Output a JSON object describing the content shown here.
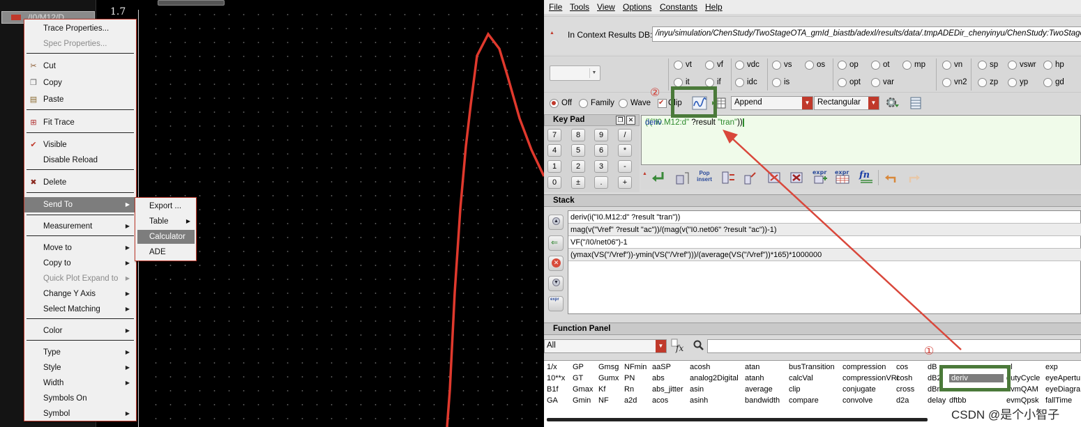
{
  "waveform": {
    "trace_name": "/I0/M12/D",
    "y_tick": "1.7",
    "trace_color": "#e0392d",
    "grid_color": "#5a5a5a"
  },
  "context_menu": {
    "trace_properties": "Trace Properties...",
    "spec_properties": "Spec Properties...",
    "cut": "Cut",
    "copy": "Copy",
    "paste": "Paste",
    "fit_trace": "Fit Trace",
    "visible": "Visible",
    "disable_reload": "Disable Reload",
    "delete": "Delete",
    "send_to": "Send To",
    "measurement": "Measurement",
    "move_to": "Move to",
    "copy_to": "Copy to",
    "quick_plot": "Quick Plot Expand to",
    "change_y_axis": "Change Y Axis",
    "select_matching": "Select Matching",
    "color": "Color",
    "type": "Type",
    "style": "Style",
    "width": "Width",
    "symbols_on": "Symbols On",
    "symbol": "Symbol"
  },
  "send_to_submenu": {
    "export": "Export ...",
    "table": "Table",
    "calculator": "Calculator",
    "ade": "ADE"
  },
  "calculator": {
    "menu": [
      "File",
      "Tools",
      "View",
      "Options",
      "Constants",
      "Help"
    ],
    "context_label": "In Context Results DB:",
    "context_path": "/inyu/simulation/ChenStudy/TwoStageOTA_gmId_biastb/adexl/results/data/.tmpADEDir_chenyinyu/ChenStudy:TwoStage",
    "signal_radios": [
      "vt",
      "vf",
      "vdc",
      "vs",
      "os",
      "op",
      "ot",
      "mp",
      "vn",
      "sp",
      "vswr",
      "hp",
      "it",
      "if",
      "idc",
      "is",
      "opt",
      "var",
      "vn2",
      "zp",
      "yp",
      "gd"
    ],
    "plot_modes": [
      "Off",
      "Family",
      "Wave"
    ],
    "clip_label": "Clip",
    "append_option": "Append",
    "shape_option": "Rectangular",
    "keypad_title": "Key Pad",
    "keypad_keys": [
      "7",
      "8",
      "9",
      "/",
      "4",
      "5",
      "6",
      "*",
      "1",
      "2",
      "3",
      "-",
      "0",
      "±",
      ".",
      "+"
    ],
    "expression": {
      "fn": "deriv",
      "p1": "(",
      "arg_fn": "i(",
      "arg_str": "\"I0.M12:d\"",
      "mid": " ?result ",
      "res_str": "\"tran\"",
      "close": "))"
    },
    "pop_insert": "Pop insert",
    "stack_title": "Stack",
    "stack_items": [
      "deriv(i(\"I0.M12:d\" ?result \"tran\"))",
      "mag(v(\"Vref\" ?result \"ac\"))/(mag(v(\"I0.net06\" ?result \"ac\"))-1)",
      "VF(\"/I0/net06\")-1",
      "(ymax(VS(\"/Vref\"))-ymin(VS(\"/Vref\")))/(average(VS(\"/Vref\"))*165)*1000000"
    ],
    "function_panel_title": "Function Panel",
    "filter_value": "All",
    "functions": [
      [
        "1/x",
        "10**x",
        "B1f",
        "GA"
      ],
      [
        "GP",
        "GT",
        "Gmax",
        "Gmin"
      ],
      [
        "Gmsg",
        "Gumx",
        "Kf",
        "NF"
      ],
      [
        "NFmin",
        "PN",
        "Rn",
        "a2d"
      ],
      [
        "aaSP",
        "abs",
        "abs_jitter",
        "acos"
      ],
      [
        "acosh",
        "analog2Digital",
        "asin",
        "asinh"
      ],
      [
        "atan",
        "atanh",
        "average",
        "bandwidth"
      ],
      [
        "busTransition",
        "calcVal",
        "clip",
        "compare"
      ],
      [
        "compression",
        "compressionVRI",
        "conjugate",
        "convolve"
      ],
      [
        "cos",
        "cosh",
        "cross",
        "d2a"
      ],
      [
        "dB",
        "dB2",
        "dBm",
        "delay"
      ],
      [
        "",
        "deriv",
        "",
        "dftbb"
      ],
      [
        "nl",
        "dutyCycle",
        "evmQAM",
        "evmQpsk"
      ],
      [
        "exp",
        "eyeApertu",
        "eyeDiagra",
        "fallTime"
      ]
    ],
    "selected_function": "deriv"
  },
  "annotations": {
    "marker_1": "①",
    "marker_2": "②",
    "arrow_color": "#d9473b",
    "box_color": "#4b7a3a"
  },
  "watermark": "CSDN @是个小智子"
}
